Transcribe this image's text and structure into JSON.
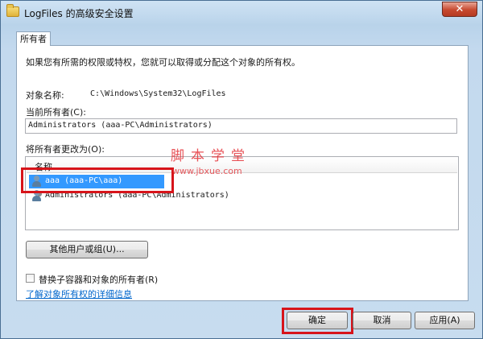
{
  "window": {
    "title": "LogFiles 的高级安全设置",
    "close_label": "✕"
  },
  "tabs": [
    {
      "label": "所有者"
    }
  ],
  "panel": {
    "intro": "如果您有所需的权限或特权，您就可以取得或分配这个对象的所有权。",
    "object_name_label": "对象名称:",
    "object_name_value": "C:\\Windows\\System32\\LogFiles",
    "current_owner_label": "当前所有者(C):",
    "current_owner_value": "Administrators (aaa-PC\\Administrators)",
    "change_owner_label": "将所有者更改为(O):",
    "list": {
      "column_name": "名称",
      "rows": [
        {
          "text": "aaa (aaa-PC\\aaa)",
          "icon": "user-icon",
          "selected": true
        },
        {
          "text": "Administrators (aaa-PC\\Administrators)",
          "icon": "group-icon",
          "selected": false
        }
      ]
    },
    "other_users_button": "其他用户或组(U)...",
    "replace_owner_checkbox": {
      "label": "替换子容器和对象的所有者(R)",
      "checked": false
    },
    "learn_more_link": "了解对象所有权的详细信息"
  },
  "buttons": {
    "ok": "确定",
    "cancel": "取消",
    "apply": "应用(A)"
  },
  "watermark": {
    "text": "脚本学堂",
    "url": "www.jbxue.com"
  },
  "colors": {
    "highlight_box": "#d7141a",
    "selection": "#3399ff",
    "link": "#0066cc"
  }
}
